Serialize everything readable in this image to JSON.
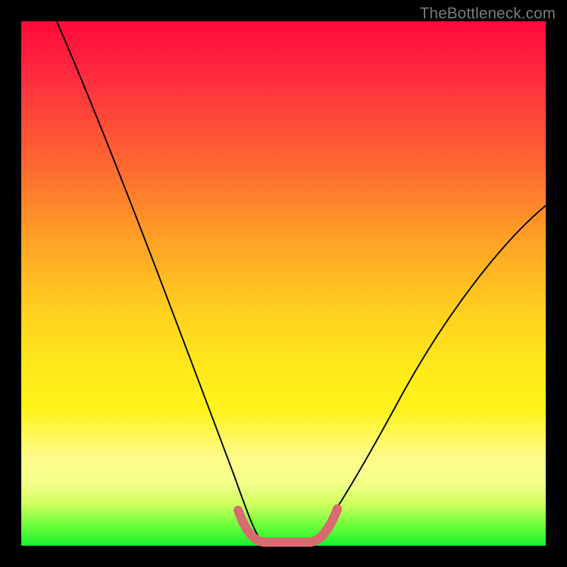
{
  "watermark": "TheBottleneck.com",
  "chart_data": {
    "type": "line",
    "title": "",
    "xlabel": "",
    "ylabel": "",
    "xlim": [
      0,
      100
    ],
    "ylim": [
      0,
      100
    ],
    "x": [
      0,
      5,
      10,
      15,
      20,
      25,
      30,
      35,
      40,
      42,
      45,
      48,
      50,
      55,
      60,
      65,
      70,
      75,
      80,
      85,
      90,
      95,
      100
    ],
    "values": [
      100,
      89,
      78,
      67,
      56,
      45,
      34,
      23,
      12,
      6,
      2,
      0,
      0,
      0,
      5,
      12,
      20,
      28,
      36,
      44,
      52,
      59,
      65
    ],
    "highlight_band": {
      "x_start": 42,
      "x_end": 58,
      "color": "#d96a6f"
    },
    "background_gradient": {
      "top": "#ff0a3a",
      "mid": "#ffe91a",
      "bottom": "#17ef2e"
    },
    "grid": false,
    "legend": false
  }
}
